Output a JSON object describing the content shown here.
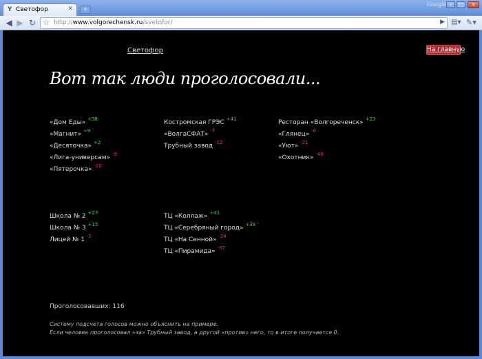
{
  "browser": {
    "tab_title": "Светофор",
    "brand": "Google",
    "url_host": "www.volgorechensk.ru",
    "url_scheme": "http://",
    "url_path": "/svetofor/"
  },
  "header": {
    "site_link": "Светофор",
    "home_button": "На главную"
  },
  "headline": "Вот так люди проголосовали...",
  "groups": [
    {
      "columns": [
        [
          {
            "name": "«Дом Еды»",
            "score": "+38",
            "sign": "plus"
          },
          {
            "name": "«Магнит»",
            "score": "+9",
            "sign": "plus"
          },
          {
            "name": "«Десяточка»",
            "score": "+2",
            "sign": "plus"
          },
          {
            "name": "«Лига-универсам»",
            "score": "-9",
            "sign": "minus"
          },
          {
            "name": "«Пятерочка»",
            "score": "-20",
            "sign": "minus"
          }
        ],
        [
          {
            "name": "Костромская ГРЭС",
            "score": "+41",
            "sign": "plus"
          },
          {
            "name": "«ВолгаСФАТ»",
            "score": "-7",
            "sign": "minus"
          },
          {
            "name": "Трубный завод",
            "score": "-12",
            "sign": "minus"
          }
        ],
        [
          {
            "name": "Ресторан «Волгореченск»",
            "score": "+23",
            "sign": "plus"
          },
          {
            "name": "«Глянец»",
            "score": "-6",
            "sign": "minus"
          },
          {
            "name": "«Уют»",
            "score": "-21",
            "sign": "minus"
          },
          {
            "name": "«Охотник»",
            "score": "-49",
            "sign": "minus"
          }
        ]
      ]
    },
    {
      "columns": [
        [
          {
            "name": "Школа № 2",
            "score": "+27",
            "sign": "plus"
          },
          {
            "name": "Школа № 3",
            "score": "+15",
            "sign": "plus"
          },
          {
            "name": "Лицей № 1",
            "score": "-5",
            "sign": "minus"
          }
        ],
        [
          {
            "name": "ТЦ «Коллаж»",
            "score": "+41",
            "sign": "plus"
          },
          {
            "name": "ТЦ «Серебряный город»",
            "score": "+38",
            "sign": "plus"
          },
          {
            "name": "ТЦ «На Сенной»",
            "score": "-24",
            "sign": "minus"
          },
          {
            "name": "ТЦ «Пирамида»",
            "score": "-37",
            "sign": "minus"
          }
        ]
      ]
    }
  ],
  "footer": {
    "voters_label": "Проголосовавших: 116",
    "note_line1": "Систему подсчета голосов можно объяснить на примере.",
    "note_line2": "Если человек проголосовал «за» Трубный завод, а другой «против» него, то в итоге получается 0."
  },
  "colors": {
    "plus": "#2cd62c",
    "minus": "#e23a3a",
    "home_button_bg": "#b1262b"
  }
}
